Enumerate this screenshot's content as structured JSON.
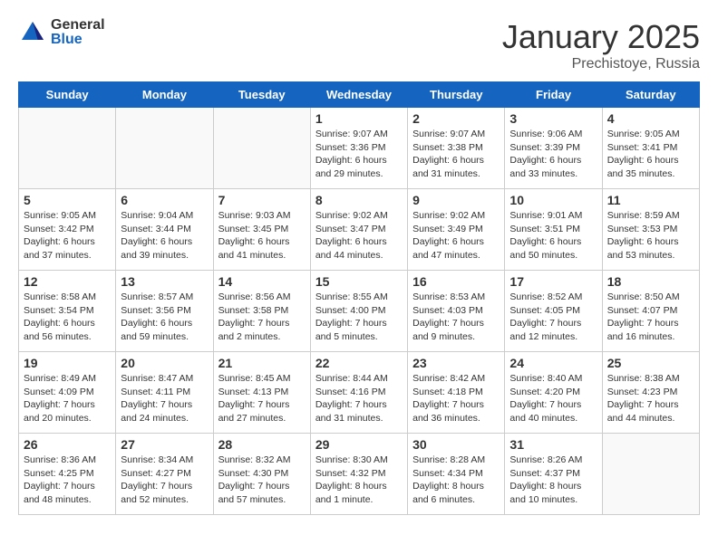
{
  "header": {
    "logo_general": "General",
    "logo_blue": "Blue",
    "title": "January 2025",
    "location": "Prechistoye, Russia"
  },
  "weekdays": [
    "Sunday",
    "Monday",
    "Tuesday",
    "Wednesday",
    "Thursday",
    "Friday",
    "Saturday"
  ],
  "weeks": [
    [
      {
        "day": "",
        "info": ""
      },
      {
        "day": "",
        "info": ""
      },
      {
        "day": "",
        "info": ""
      },
      {
        "day": "1",
        "info": "Sunrise: 9:07 AM\nSunset: 3:36 PM\nDaylight: 6 hours and 29 minutes."
      },
      {
        "day": "2",
        "info": "Sunrise: 9:07 AM\nSunset: 3:38 PM\nDaylight: 6 hours and 31 minutes."
      },
      {
        "day": "3",
        "info": "Sunrise: 9:06 AM\nSunset: 3:39 PM\nDaylight: 6 hours and 33 minutes."
      },
      {
        "day": "4",
        "info": "Sunrise: 9:05 AM\nSunset: 3:41 PM\nDaylight: 6 hours and 35 minutes."
      }
    ],
    [
      {
        "day": "5",
        "info": "Sunrise: 9:05 AM\nSunset: 3:42 PM\nDaylight: 6 hours and 37 minutes."
      },
      {
        "day": "6",
        "info": "Sunrise: 9:04 AM\nSunset: 3:44 PM\nDaylight: 6 hours and 39 minutes."
      },
      {
        "day": "7",
        "info": "Sunrise: 9:03 AM\nSunset: 3:45 PM\nDaylight: 6 hours and 41 minutes."
      },
      {
        "day": "8",
        "info": "Sunrise: 9:02 AM\nSunset: 3:47 PM\nDaylight: 6 hours and 44 minutes."
      },
      {
        "day": "9",
        "info": "Sunrise: 9:02 AM\nSunset: 3:49 PM\nDaylight: 6 hours and 47 minutes."
      },
      {
        "day": "10",
        "info": "Sunrise: 9:01 AM\nSunset: 3:51 PM\nDaylight: 6 hours and 50 minutes."
      },
      {
        "day": "11",
        "info": "Sunrise: 8:59 AM\nSunset: 3:53 PM\nDaylight: 6 hours and 53 minutes."
      }
    ],
    [
      {
        "day": "12",
        "info": "Sunrise: 8:58 AM\nSunset: 3:54 PM\nDaylight: 6 hours and 56 minutes."
      },
      {
        "day": "13",
        "info": "Sunrise: 8:57 AM\nSunset: 3:56 PM\nDaylight: 6 hours and 59 minutes."
      },
      {
        "day": "14",
        "info": "Sunrise: 8:56 AM\nSunset: 3:58 PM\nDaylight: 7 hours and 2 minutes."
      },
      {
        "day": "15",
        "info": "Sunrise: 8:55 AM\nSunset: 4:00 PM\nDaylight: 7 hours and 5 minutes."
      },
      {
        "day": "16",
        "info": "Sunrise: 8:53 AM\nSunset: 4:03 PM\nDaylight: 7 hours and 9 minutes."
      },
      {
        "day": "17",
        "info": "Sunrise: 8:52 AM\nSunset: 4:05 PM\nDaylight: 7 hours and 12 minutes."
      },
      {
        "day": "18",
        "info": "Sunrise: 8:50 AM\nSunset: 4:07 PM\nDaylight: 7 hours and 16 minutes."
      }
    ],
    [
      {
        "day": "19",
        "info": "Sunrise: 8:49 AM\nSunset: 4:09 PM\nDaylight: 7 hours and 20 minutes."
      },
      {
        "day": "20",
        "info": "Sunrise: 8:47 AM\nSunset: 4:11 PM\nDaylight: 7 hours and 24 minutes."
      },
      {
        "day": "21",
        "info": "Sunrise: 8:45 AM\nSunset: 4:13 PM\nDaylight: 7 hours and 27 minutes."
      },
      {
        "day": "22",
        "info": "Sunrise: 8:44 AM\nSunset: 4:16 PM\nDaylight: 7 hours and 31 minutes."
      },
      {
        "day": "23",
        "info": "Sunrise: 8:42 AM\nSunset: 4:18 PM\nDaylight: 7 hours and 36 minutes."
      },
      {
        "day": "24",
        "info": "Sunrise: 8:40 AM\nSunset: 4:20 PM\nDaylight: 7 hours and 40 minutes."
      },
      {
        "day": "25",
        "info": "Sunrise: 8:38 AM\nSunset: 4:23 PM\nDaylight: 7 hours and 44 minutes."
      }
    ],
    [
      {
        "day": "26",
        "info": "Sunrise: 8:36 AM\nSunset: 4:25 PM\nDaylight: 7 hours and 48 minutes."
      },
      {
        "day": "27",
        "info": "Sunrise: 8:34 AM\nSunset: 4:27 PM\nDaylight: 7 hours and 52 minutes."
      },
      {
        "day": "28",
        "info": "Sunrise: 8:32 AM\nSunset: 4:30 PM\nDaylight: 7 hours and 57 minutes."
      },
      {
        "day": "29",
        "info": "Sunrise: 8:30 AM\nSunset: 4:32 PM\nDaylight: 8 hours and 1 minute."
      },
      {
        "day": "30",
        "info": "Sunrise: 8:28 AM\nSunset: 4:34 PM\nDaylight: 8 hours and 6 minutes."
      },
      {
        "day": "31",
        "info": "Sunrise: 8:26 AM\nSunset: 4:37 PM\nDaylight: 8 hours and 10 minutes."
      },
      {
        "day": "",
        "info": ""
      }
    ]
  ]
}
